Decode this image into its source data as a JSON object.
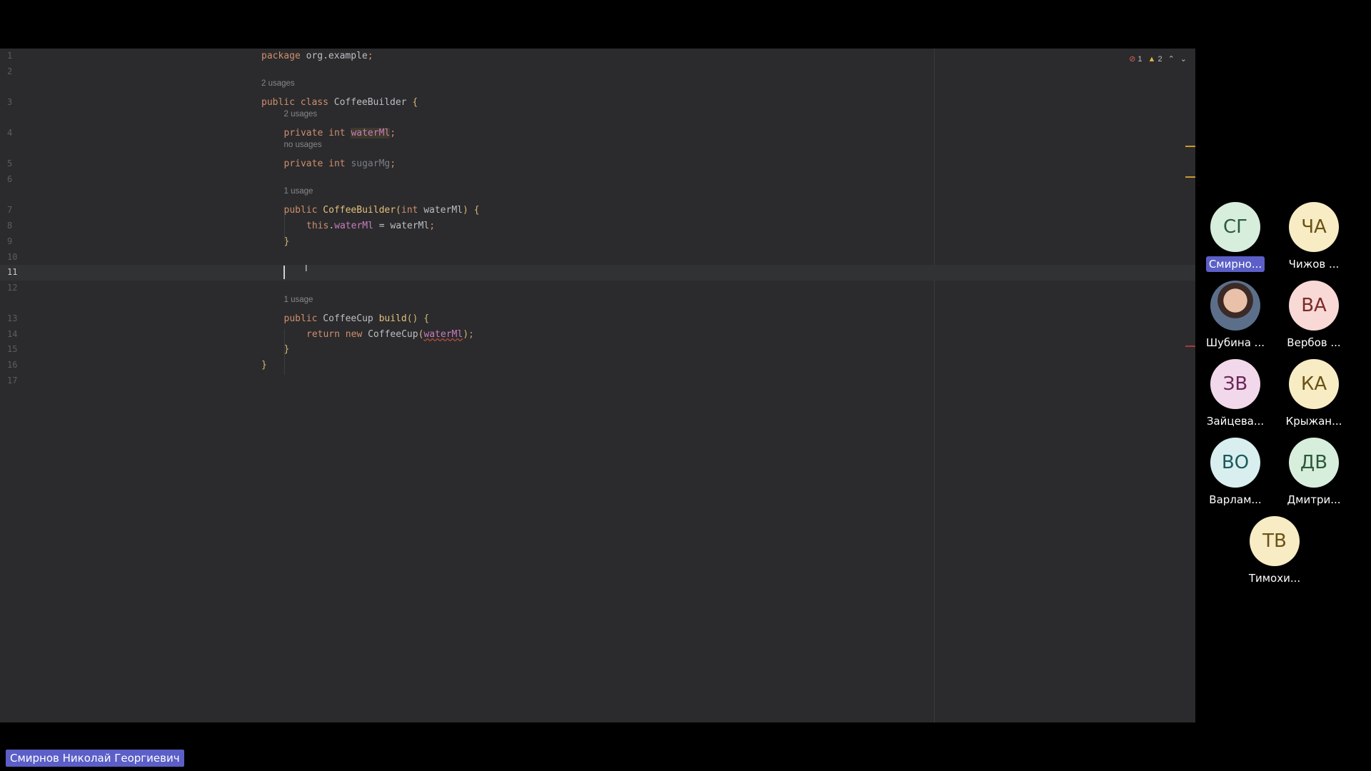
{
  "editor": {
    "lines": [
      {
        "num": "1",
        "hint": "",
        "tokens": [
          {
            "t": "package ",
            "c": "kw"
          },
          {
            "t": "org.example",
            "c": ""
          },
          {
            "t": ";",
            "c": "kw"
          }
        ],
        "indent": 0
      },
      {
        "num": "2",
        "hint": "",
        "tokens": [],
        "indent": 0
      },
      {
        "num": "3",
        "hint": "2 usages",
        "tokens": [
          {
            "t": "public ",
            "c": "kw"
          },
          {
            "t": "class ",
            "c": "kw"
          },
          {
            "t": "CoffeeBuilder ",
            "c": ""
          },
          {
            "t": "{",
            "c": "brace"
          }
        ],
        "indent": 0
      },
      {
        "num": "4",
        "hint": "2 usages",
        "tokens": [
          {
            "t": "private ",
            "c": "kw"
          },
          {
            "t": "int ",
            "c": "kw"
          },
          {
            "t": "waterMl",
            "c": "fld hl"
          },
          {
            "t": ";",
            "c": "kw"
          }
        ],
        "indent": 1
      },
      {
        "num": "5",
        "hint": "no usages",
        "tokens": [
          {
            "t": "private ",
            "c": "kw"
          },
          {
            "t": "int ",
            "c": "kw"
          },
          {
            "t": "sugarMg",
            "c": "dim"
          },
          {
            "t": ";",
            "c": "kw"
          }
        ],
        "indent": 1
      },
      {
        "num": "6",
        "hint": "",
        "tokens": [],
        "indent": 0
      },
      {
        "num": "7",
        "hint": "1 usage",
        "tokens": [
          {
            "t": "public ",
            "c": "kw"
          },
          {
            "t": "CoffeeBuilder",
            "c": "fnd"
          },
          {
            "t": "(",
            "c": "brace"
          },
          {
            "t": "int ",
            "c": "kw"
          },
          {
            "t": "waterMl",
            "c": ""
          },
          {
            "t": ") ",
            "c": "brace"
          },
          {
            "t": "{",
            "c": "brace"
          }
        ],
        "indent": 1
      },
      {
        "num": "8",
        "hint": "",
        "tokens": [
          {
            "t": "this",
            "c": "kw"
          },
          {
            "t": ".",
            "c": ""
          },
          {
            "t": "waterMl",
            "c": "fld"
          },
          {
            "t": " = waterMl",
            "c": ""
          },
          {
            "t": ";",
            "c": "kw"
          }
        ],
        "indent": 2
      },
      {
        "num": "9",
        "hint": "",
        "tokens": [
          {
            "t": "}",
            "c": "brace"
          }
        ],
        "indent": 1
      },
      {
        "num": "10",
        "hint": "",
        "tokens": [],
        "indent": 0
      },
      {
        "num": "11",
        "hint": "",
        "tokens": [],
        "indent": 0,
        "current": true
      },
      {
        "num": "12",
        "hint": "",
        "tokens": [],
        "indent": 0
      },
      {
        "num": "13",
        "hint": "1 usage",
        "tokens": [
          {
            "t": "public ",
            "c": "kw"
          },
          {
            "t": "CoffeeCup ",
            "c": ""
          },
          {
            "t": "build",
            "c": "fnd"
          },
          {
            "t": "() ",
            "c": "brace"
          },
          {
            "t": "{",
            "c": "brace"
          }
        ],
        "indent": 1
      },
      {
        "num": "14",
        "hint": "",
        "tokens": [
          {
            "t": "return ",
            "c": "kw"
          },
          {
            "t": "new ",
            "c": "kw"
          },
          {
            "t": "CoffeeCup",
            "c": ""
          },
          {
            "t": "(",
            "c": "brace"
          },
          {
            "t": "waterMl",
            "c": "fld err"
          },
          {
            "t": ")",
            "c": "brace"
          },
          {
            "t": ";",
            "c": "kw"
          }
        ],
        "indent": 2
      },
      {
        "num": "15",
        "hint": "",
        "tokens": [
          {
            "t": "}",
            "c": "brace"
          }
        ],
        "indent": 1
      },
      {
        "num": "16",
        "hint": "",
        "tokens": [
          {
            "t": "}",
            "c": "brace"
          }
        ],
        "indent": 0
      },
      {
        "num": "17",
        "hint": "",
        "tokens": [],
        "indent": 0
      }
    ],
    "inspections": {
      "errors": "1",
      "warnings": "2",
      "error_icon": "error-circle-icon",
      "warning_icon": "warning-triangle-icon"
    },
    "colors": {
      "background": "#2b2b2d",
      "keyword": "#cf8e6d",
      "field": "#c77dbb",
      "function": "#e5c07b"
    }
  },
  "participants": [
    {
      "initials": "СГ",
      "name": "Смирно...",
      "bg": "#d8eedd",
      "fg": "#2b5a3a",
      "active": true
    },
    {
      "initials": "ЧА",
      "name": "Чижов ...",
      "bg": "#f7ecc4",
      "fg": "#6b5216"
    },
    {
      "initials": "",
      "name": "Шубина ...",
      "photo": true
    },
    {
      "initials": "ВА",
      "name": "Вербов ...",
      "bg": "#f8d9d6",
      "fg": "#7b2a26"
    },
    {
      "initials": "ЗВ",
      "name": "Зайцева...",
      "bg": "#f1d8ea",
      "fg": "#6b2758"
    },
    {
      "initials": "КА",
      "name": "Крыжан...",
      "bg": "#f7ecc4",
      "fg": "#6b5216"
    },
    {
      "initials": "ВО",
      "name": "Варлам...",
      "bg": "#d9efef",
      "fg": "#1d5a5c"
    },
    {
      "initials": "ДВ",
      "name": "Дмитри...",
      "bg": "#d8eedd",
      "fg": "#2b5a3a"
    },
    {
      "initials": "ТВ",
      "name": "Тимохи...",
      "bg": "#f7ecc4",
      "fg": "#6b5216"
    }
  ],
  "speaker": {
    "name": "Смирнов Николай Георгиевич"
  },
  "accent": "#5b5fc7"
}
